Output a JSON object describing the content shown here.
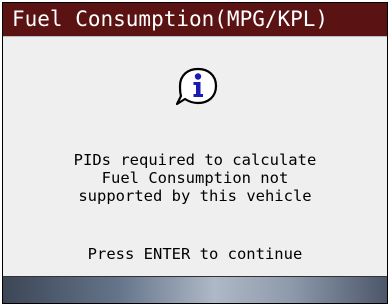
{
  "window": {
    "title": "Fuel Consumption(MPG/KPL)"
  },
  "dialog": {
    "icon": "info-icon",
    "message_lines": [
      "PIDs required to calculate",
      "Fuel Consumption not",
      "supported by this vehicle"
    ],
    "prompt": "Press ENTER to continue"
  },
  "colors": {
    "title_bar": "#5b1212",
    "title_text": "#ffffff",
    "content_bg": "#efefef",
    "icon_fill": "#ffffff",
    "icon_glyph": "#1a1ab4"
  }
}
